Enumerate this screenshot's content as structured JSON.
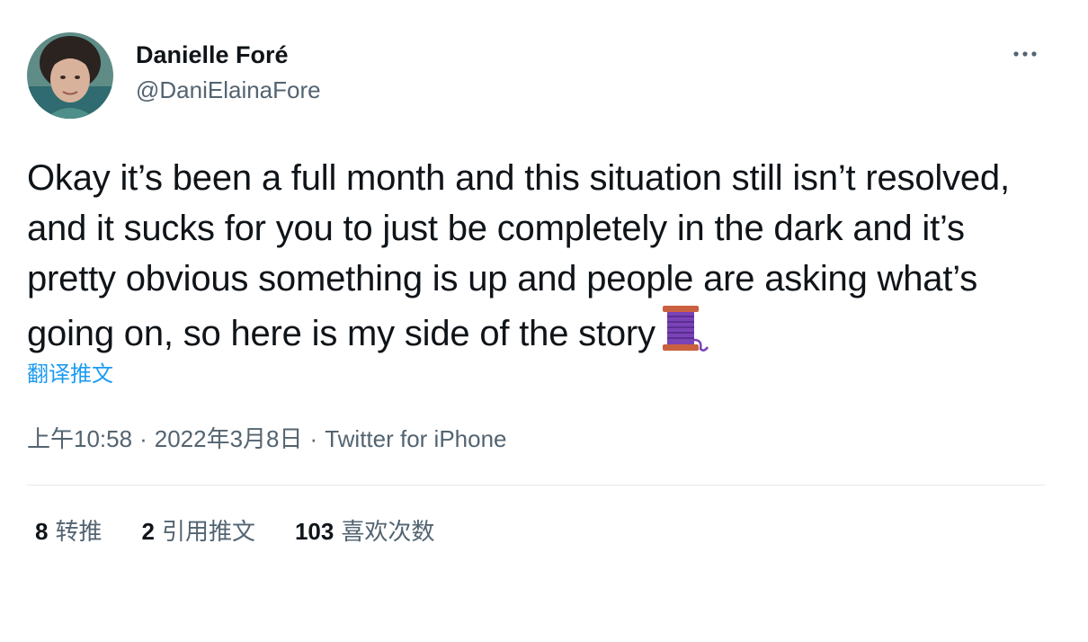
{
  "author": {
    "display_name": "Danielle Foré",
    "handle": "@DaniElainaFore",
    "avatar_icon": "profile-photo"
  },
  "more_icon": "more-dots-icon",
  "tweet": {
    "text": "Okay it’s been a full month and this situation still isn’t resolved, and it sucks for you to just be completely in the dark and it’s pretty obvious something is up and people are asking what’s going on, so here is my side of the story",
    "emoji_icon": "thread-spool-icon",
    "translate_label": "翻译推文"
  },
  "meta": {
    "time": "上午10:58",
    "separator": "·",
    "date": "2022年3月8日",
    "source": "Twitter for iPhone"
  },
  "stats": {
    "retweets_count": "8",
    "retweets_label": "转推",
    "quotes_count": "2",
    "quotes_label": "引用推文",
    "likes_count": "103",
    "likes_label": "喜欢次数"
  },
  "colors": {
    "text_primary": "#0f1419",
    "text_secondary": "#536471",
    "link": "#1d9bf0",
    "divider": "#e6e9ea"
  }
}
